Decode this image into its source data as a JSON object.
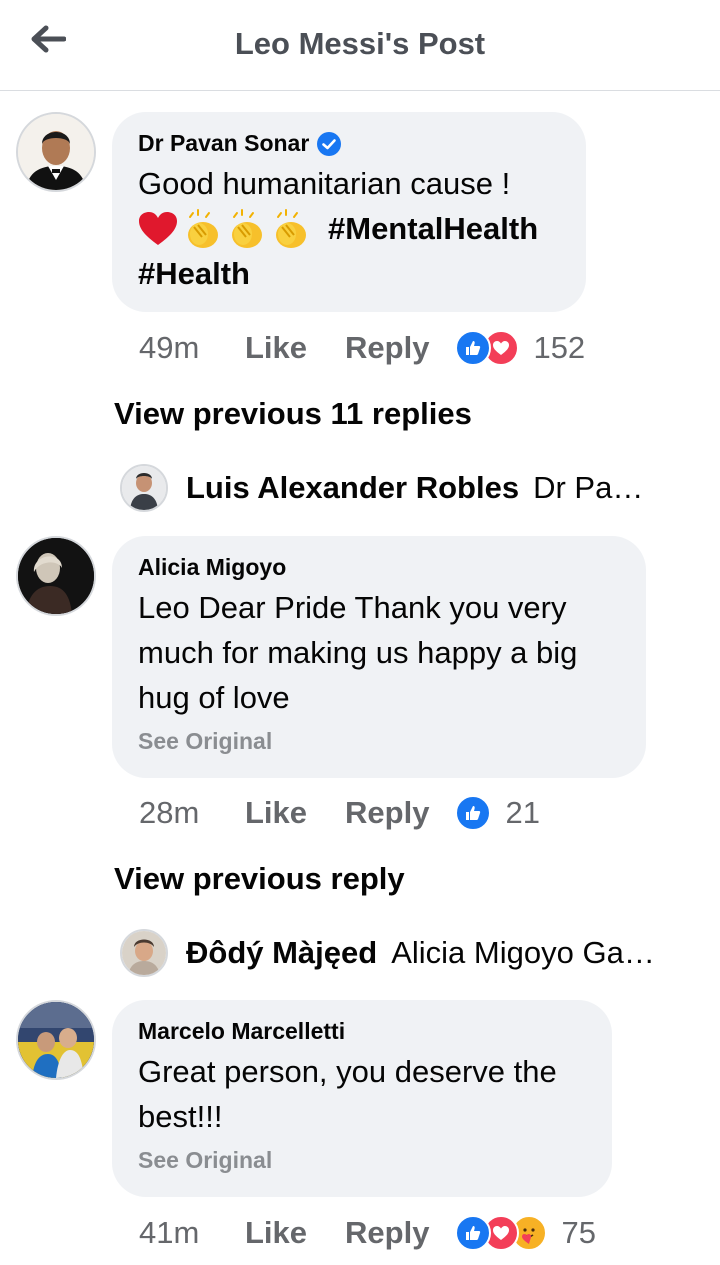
{
  "header": {
    "title": "Leo Messi's Post",
    "back_icon": "arrow-left-icon"
  },
  "comments": [
    {
      "author": "Dr Pavan Sonar",
      "verified": true,
      "text_line1": "Good humanitarian cause !",
      "hashtag1": "#MentalHealth",
      "hashtag2": "#Health",
      "time": "49m",
      "like": "Like",
      "reply": "Reply",
      "reactions": [
        "like",
        "love"
      ],
      "count": "152"
    },
    {
      "author": "Alicia Migoyo",
      "text": "Leo Dear Pride Thank you very much for making us happy a big hug of love",
      "see_original": "See Original",
      "time": "28m",
      "like": "Like",
      "reply": "Reply",
      "reactions": [
        "like"
      ],
      "count": "21"
    },
    {
      "author": "Marcelo Marcelletti",
      "text": "Great person, you deserve the best!!!",
      "see_original": "See Original",
      "time": "41m",
      "like": "Like",
      "reply": "Reply",
      "reactions": [
        "like",
        "love",
        "care"
      ],
      "count": "75"
    }
  ],
  "view_prev_1": "View previous 11 replies",
  "reply_preview_1": {
    "name": "Luis Alexander Robles",
    "snippet": "Dr Pavan Sonar"
  },
  "view_prev_2": "View previous reply",
  "reply_preview_2": {
    "name": "Đôdý Màjęed",
    "snippet": "Alicia Migoyo Gabriel"
  },
  "colors": {
    "like_blue": "#1877f2",
    "love_red": "#f33e58",
    "care_yellow": "#f7b125",
    "bubble": "#f0f2f5",
    "muted": "#65676b"
  }
}
